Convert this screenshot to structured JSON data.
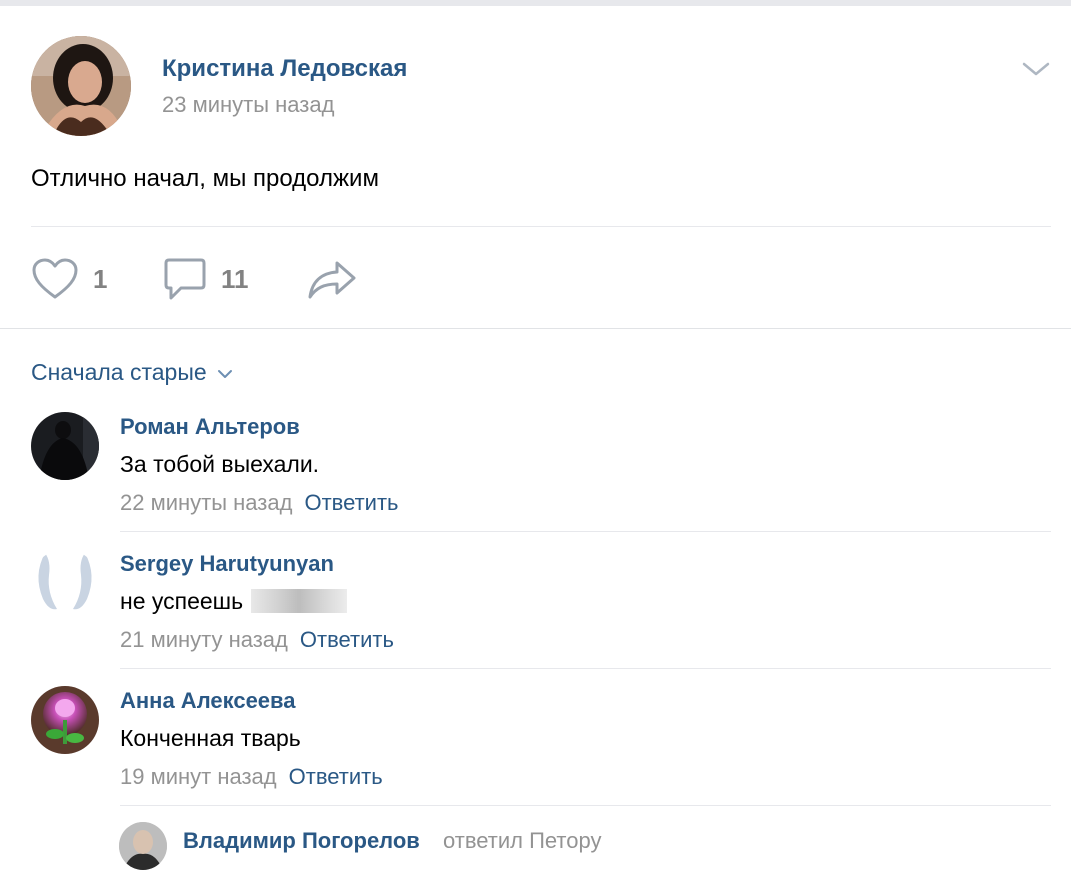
{
  "post": {
    "author": "Кристина Ледовская",
    "time": "23 минуты назад",
    "text": "Отлично начал, мы продолжим",
    "likes": "1",
    "comments": "11"
  },
  "sort_label": "Сначала старые",
  "comments": [
    {
      "author": "Роман Альтеров",
      "text": "За тобой выехали.",
      "time": "22 минуты назад",
      "reply": "Ответить"
    },
    {
      "author": "Sergey Harutyunyan",
      "text": "не успеешь",
      "time": "21 минуту назад",
      "reply": "Ответить"
    },
    {
      "author": "Анна Алексеева",
      "text": "Конченная тварь",
      "time": "19 минут назад",
      "reply": "Ответить"
    }
  ],
  "reply_preview": {
    "author": "Владимир Погорелов",
    "replied_to": "ответил Петору"
  },
  "colors": {
    "link": "#2a5885",
    "meta": "#939393",
    "icon": "#99a2ad",
    "divider": "#e7e8ec"
  },
  "icons": [
    "menu-chevron-icon",
    "like-icon",
    "comment-icon",
    "share-icon",
    "sort-chevron-icon"
  ]
}
